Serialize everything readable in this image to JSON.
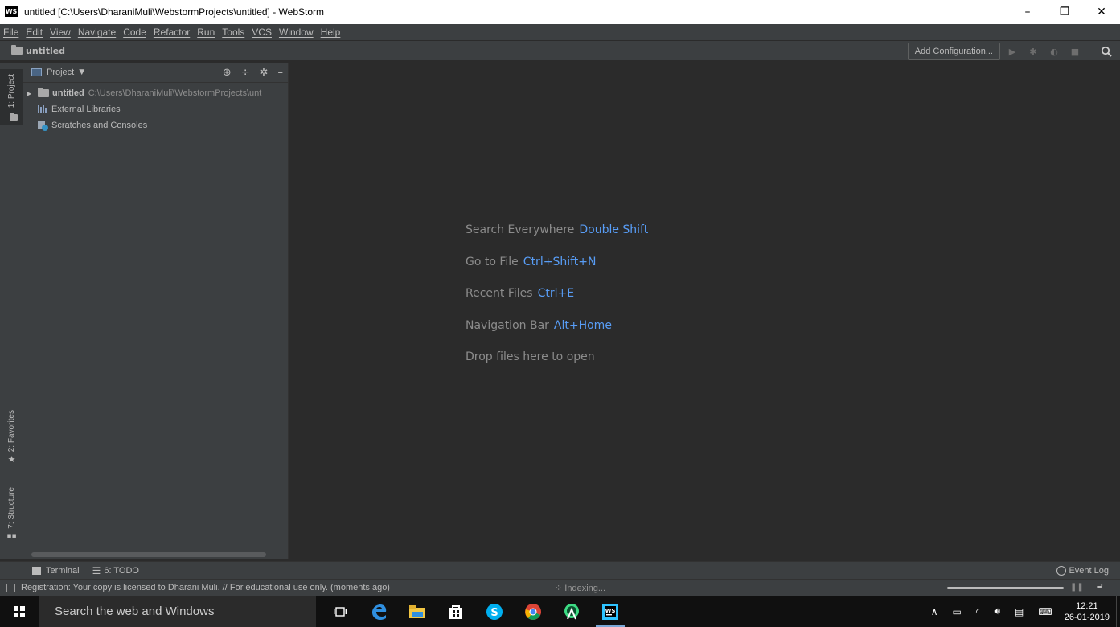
{
  "window": {
    "title": "untitled [C:\\Users\\DharaniMuli\\WebstormProjects\\untitled] - WebStorm",
    "logo_text": "WS",
    "minimize": "–",
    "restore": "❐",
    "close": "✕"
  },
  "menu": [
    "File",
    "Edit",
    "View",
    "Navigate",
    "Code",
    "Refactor",
    "Run",
    "Tools",
    "VCS",
    "Window",
    "Help"
  ],
  "navbar": {
    "project": "untitled",
    "add_configuration": "Add Configuration..."
  },
  "left_stripe": {
    "project_tab": "1: Project",
    "favorites_tab": "2: Favorites",
    "structure_tab": "7: Structure"
  },
  "project_panel": {
    "title": "Project",
    "tree": [
      {
        "name": "untitled",
        "path": "C:\\Users\\DharaniMuli\\WebstormProjects\\unt"
      },
      {
        "name": "External Libraries"
      },
      {
        "name": "Scratches and Consoles"
      }
    ]
  },
  "editor": {
    "hints": [
      {
        "label": "Search Everywhere",
        "key": "Double Shift"
      },
      {
        "label": "Go to File",
        "key": "Ctrl+Shift+N"
      },
      {
        "label": "Recent Files",
        "key": "Ctrl+E"
      },
      {
        "label": "Navigation Bar",
        "key": "Alt+Home"
      },
      {
        "label": "Drop files here to open",
        "key": ""
      }
    ]
  },
  "bottom_tools": {
    "terminal": "Terminal",
    "todo": "6: TODO",
    "event_log": "Event Log"
  },
  "status": {
    "message": "Registration: Your copy is licensed to Dharani Muli. // For educational use only. (moments ago)",
    "indexing": "Indexing..."
  },
  "taskbar": {
    "search_placeholder": "Search the web and Windows",
    "time": "12:21",
    "date": "26-01-2019"
  },
  "colors": {
    "background": "#2b2b2b",
    "panel": "#3c3f41",
    "shortcut_key": "#589df6"
  }
}
